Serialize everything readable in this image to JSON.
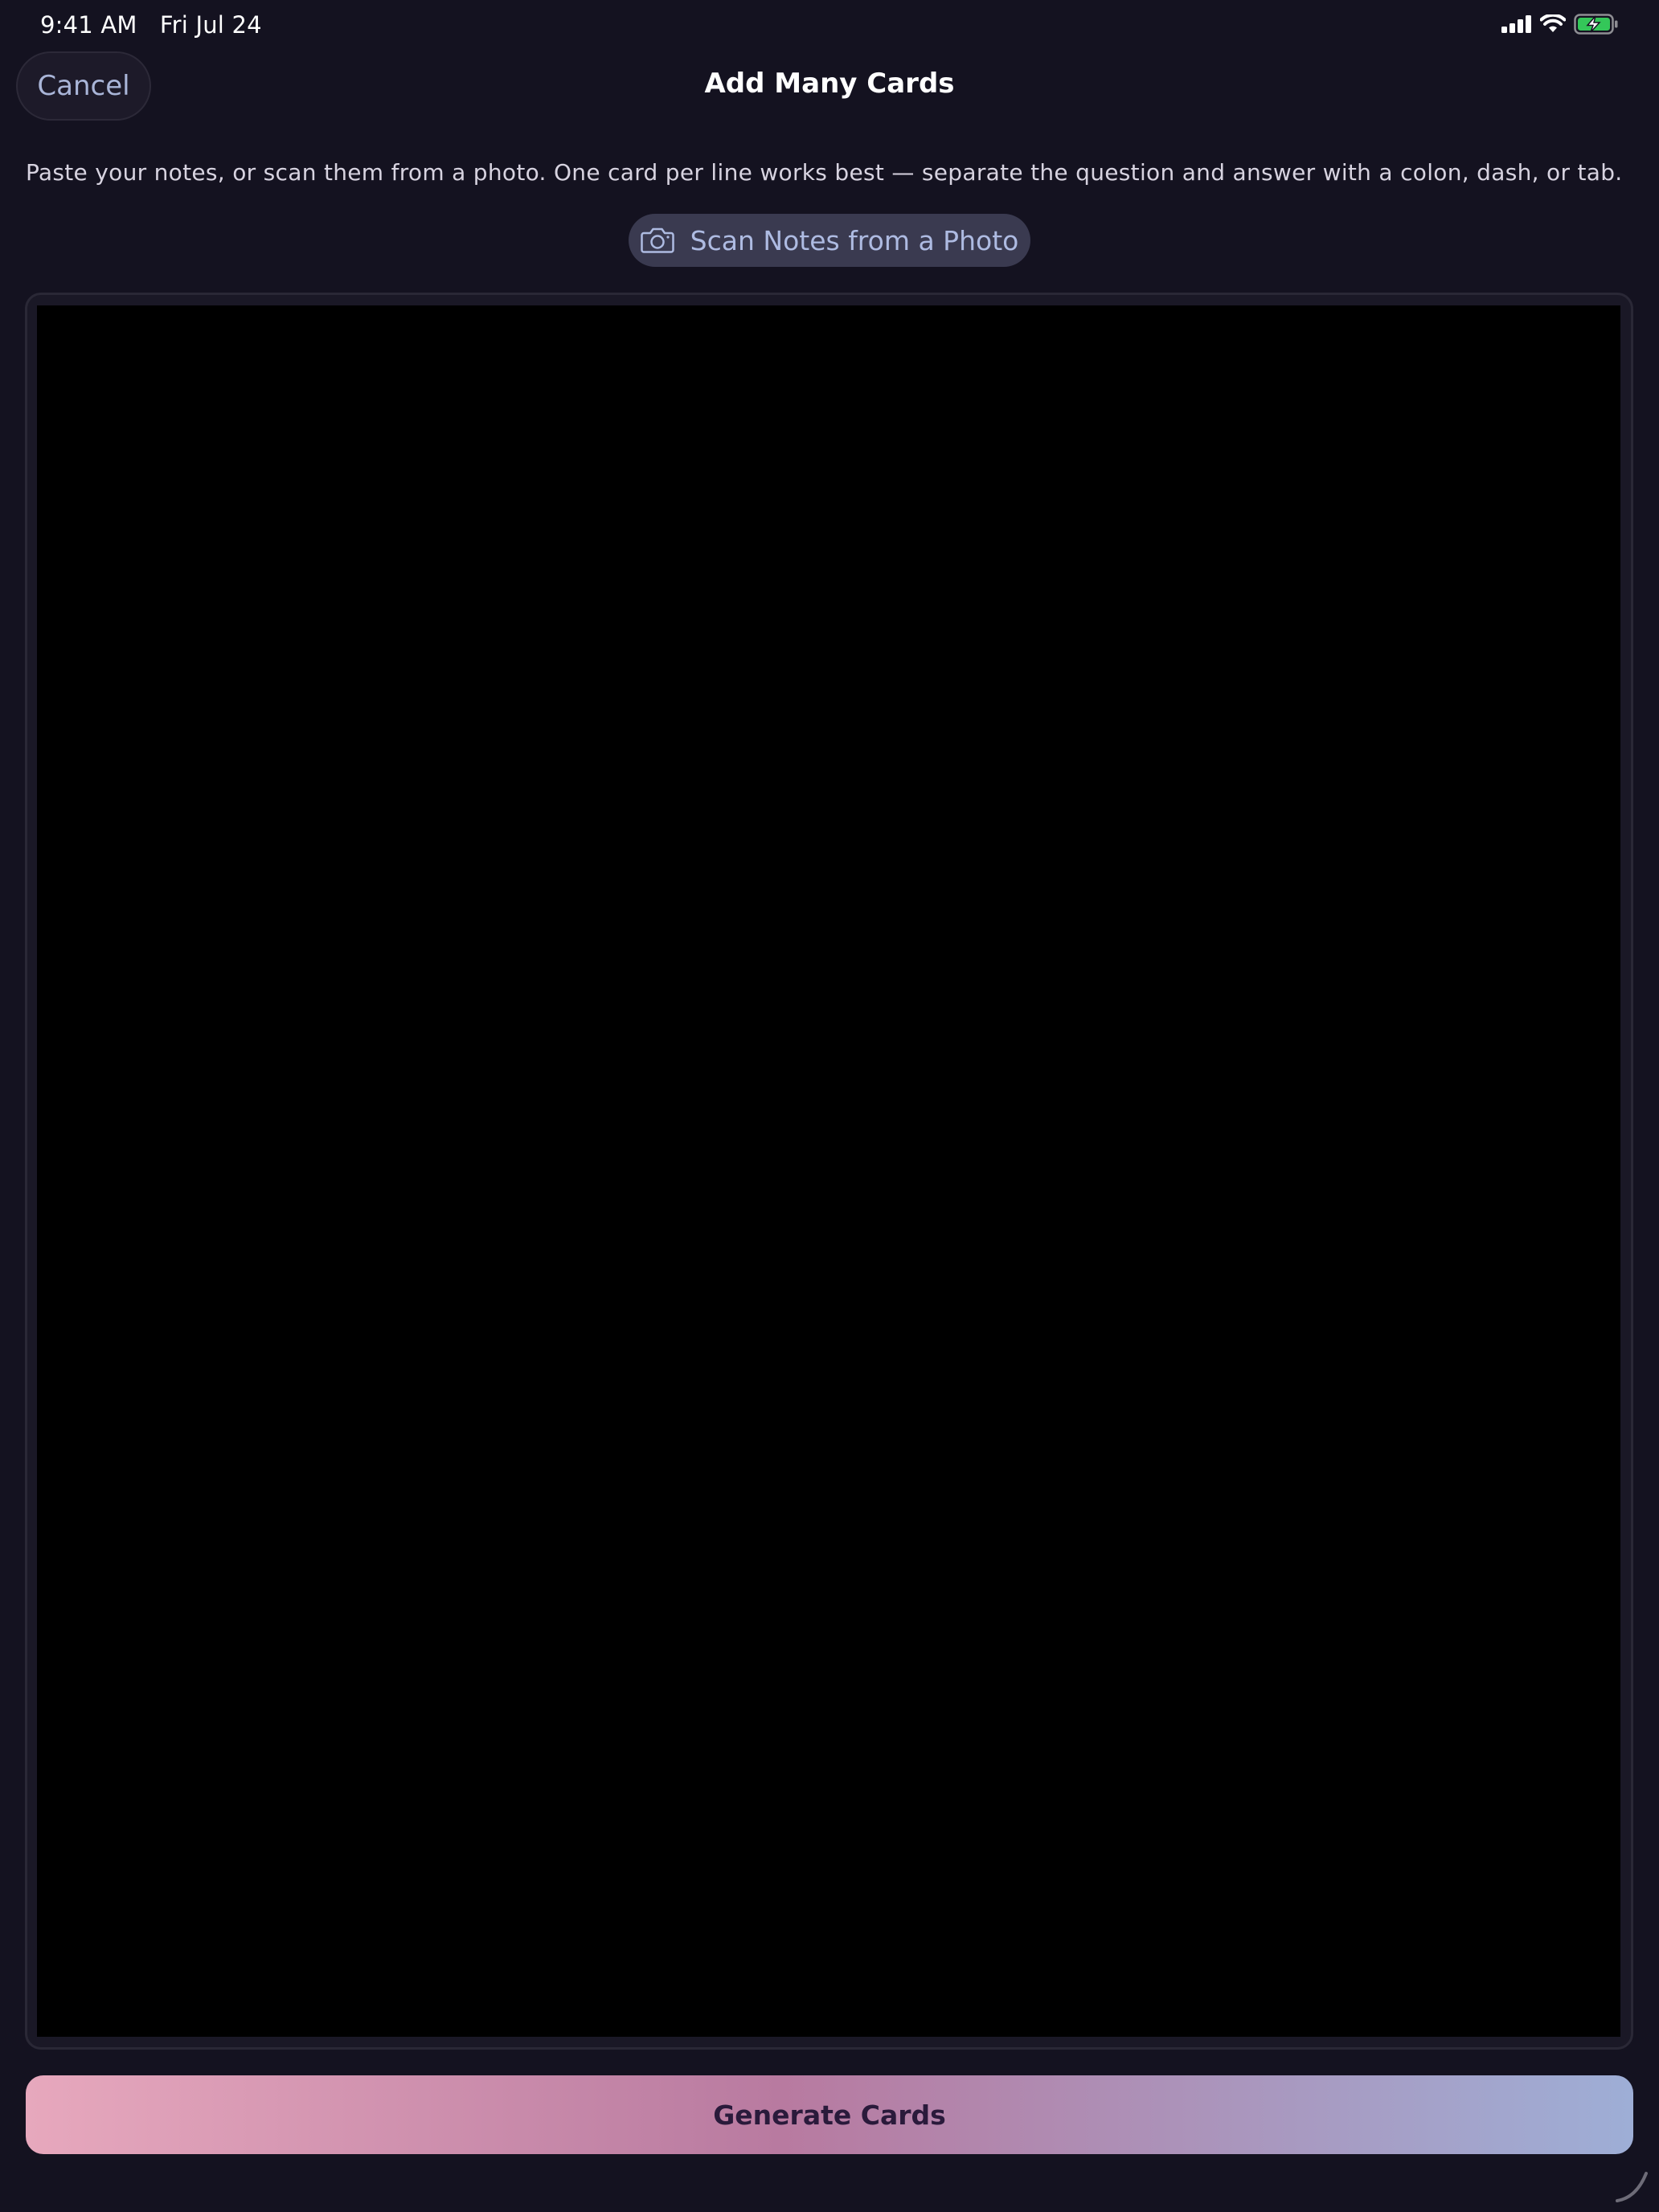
{
  "status_bar": {
    "time": "9:41 AM",
    "date": "Fri Jul 24",
    "icons": [
      "cellular-signal-icon",
      "wifi-icon",
      "battery-charging-icon"
    ],
    "battery_color": "#34c759"
  },
  "nav": {
    "cancel_label": "Cancel",
    "title": "Add Many Cards"
  },
  "instructions": "Paste your notes, or scan them from a photo. One card per line works best — separate the question and answer with a colon, dash, or tab.",
  "scan_button": {
    "icon": "camera-icon",
    "label": "Scan Notes from a Photo"
  },
  "editor": {
    "value": ""
  },
  "generate_button": {
    "label": "Generate Cards",
    "gradient": [
      "#e7a8bd",
      "#b87aa0",
      "#9eaed6"
    ]
  },
  "colors": {
    "background": "#141220",
    "accent_text": "#a9b5d8"
  }
}
